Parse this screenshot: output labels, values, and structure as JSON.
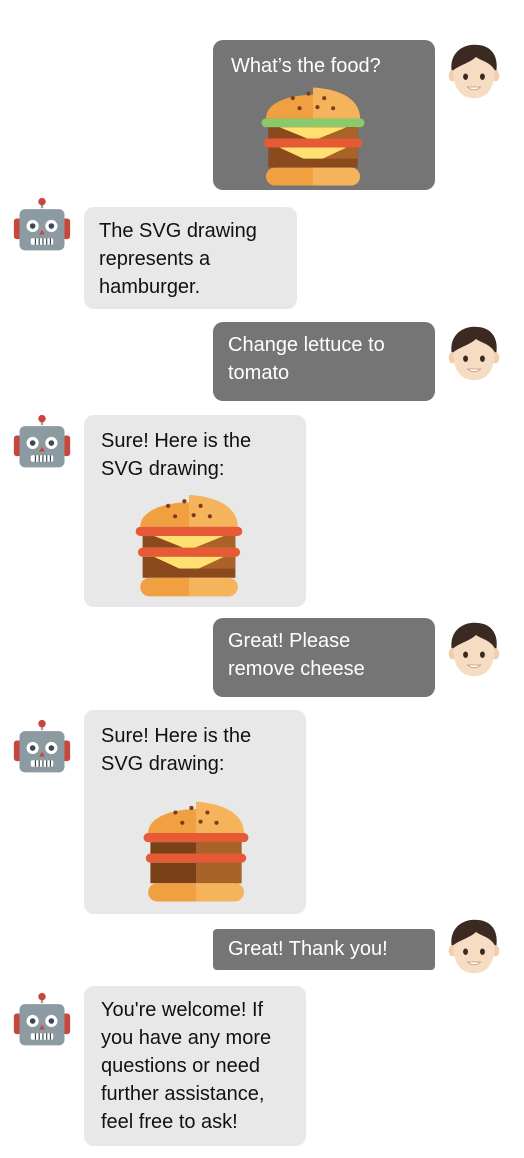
{
  "conversation": {
    "m1": {
      "text": "What’s the food?"
    },
    "m2": {
      "text": "The SVG drawing\nrepresents a\nhamburger."
    },
    "m3": {
      "text": "Change lettuce to\ntomato"
    },
    "m4": {
      "text": "Sure! Here is the\nSVG drawing:"
    },
    "m5": {
      "text": "Great! Please\nremove cheese"
    },
    "m6": {
      "text": "Sure! Here is the\nSVG drawing:"
    },
    "m7": {
      "text": "Great! Thank you!"
    },
    "m8": {
      "text": "You're welcome! If\nyou have any more\nquestions or need\nfurther assistance,\nfeel free to ask!"
    }
  },
  "icons": {
    "user": "boy-face-icon",
    "bot": "robot-face-icon",
    "drawing": "hamburger-icon"
  },
  "colors": {
    "user_bubble": "#757575",
    "bot_bubble": "#e8e8e8",
    "bun": "#f0a040",
    "lettuce": "#8dc86a",
    "tomato": "#e65b35",
    "cheese": "#ffe070",
    "patty": "#8a4a1e"
  }
}
